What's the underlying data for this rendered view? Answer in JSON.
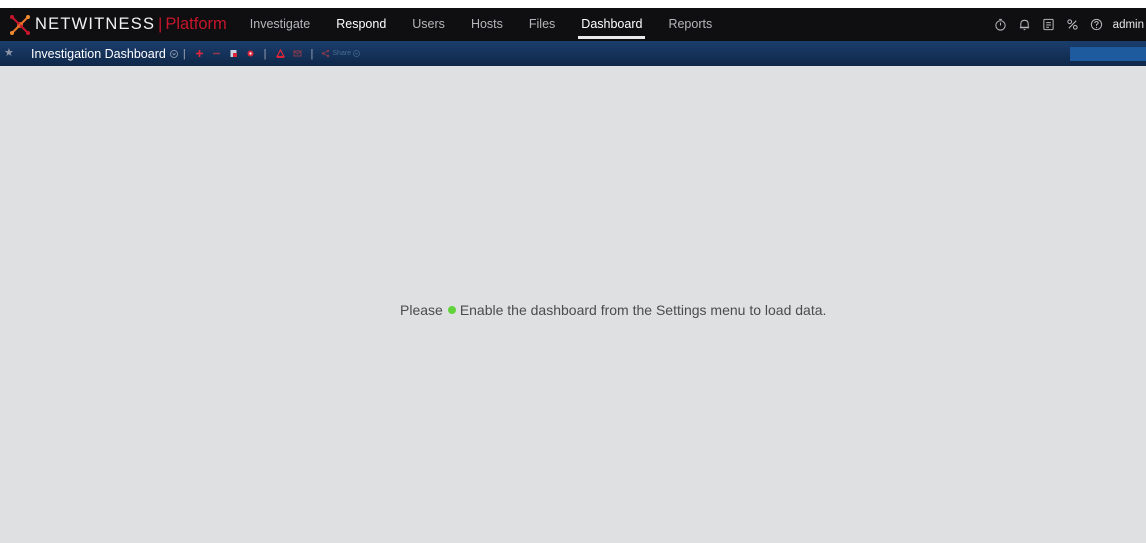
{
  "brand": {
    "name": "NETWITNESS",
    "separator": "|",
    "product": "Platform"
  },
  "nav": {
    "items": [
      {
        "label": "Investigate"
      },
      {
        "label": "Respond"
      },
      {
        "label": "Users"
      },
      {
        "label": "Hosts"
      },
      {
        "label": "Files"
      },
      {
        "label": "Dashboard"
      },
      {
        "label": "Reports"
      }
    ],
    "active": "Dashboard"
  },
  "header_tools": {
    "icons": [
      "timer-icon",
      "bell-icon",
      "notes-icon",
      "tools-icon",
      "help-icon"
    ],
    "user": "admin"
  },
  "dashboard_bar": {
    "title": "Investigation Dashboard",
    "share_label": "Share",
    "button_label": ""
  },
  "content": {
    "message_before": "Please",
    "message_after": "Enable the dashboard from the Settings menu to load data.",
    "status_color": "#61d43b"
  },
  "colors": {
    "brand_accent": "#c7152b",
    "topbar_bg": "#0f0f11",
    "dashbar_bg": "#163460",
    "content_bg": "#dfe0e1"
  }
}
